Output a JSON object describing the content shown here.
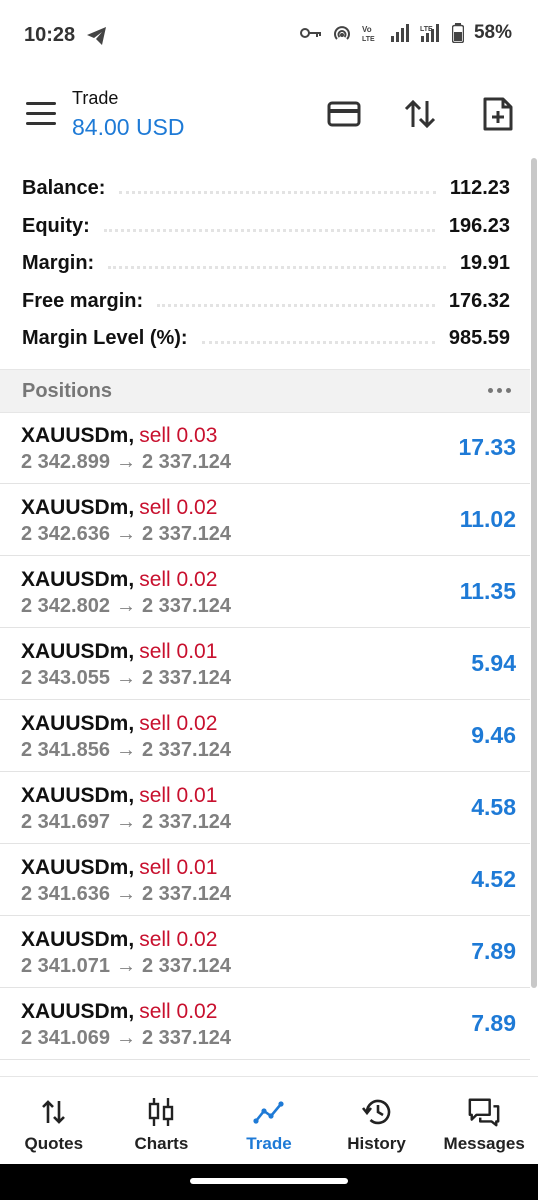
{
  "status_bar": {
    "time": "10:28",
    "battery": "58%",
    "icons": [
      "telegram-icon",
      "key-icon",
      "hotspot-icon",
      "volte-icon",
      "signal-icon",
      "lte-signal-icon",
      "battery-icon"
    ]
  },
  "header": {
    "title": "Trade",
    "balance": "84.00 USD",
    "icons": [
      "menu-icon",
      "card-icon",
      "sort-icon",
      "new-order-icon"
    ]
  },
  "account": [
    {
      "label": "Balance:",
      "value": "112.23"
    },
    {
      "label": "Equity:",
      "value": "196.23"
    },
    {
      "label": "Margin:",
      "value": "19.91"
    },
    {
      "label": "Free margin:",
      "value": "176.32"
    },
    {
      "label": "Margin Level (%):",
      "value": "985.59"
    }
  ],
  "positions_header": {
    "title": "Positions"
  },
  "positions": [
    {
      "symbol": "XAUUSDm,",
      "type": "sell 0.03",
      "open": "2 342.899",
      "current": "2 337.124",
      "profit": "17.33"
    },
    {
      "symbol": "XAUUSDm,",
      "type": "sell 0.02",
      "open": "2 342.636",
      "current": "2 337.124",
      "profit": "11.02"
    },
    {
      "symbol": "XAUUSDm,",
      "type": "sell 0.02",
      "open": "2 342.802",
      "current": "2 337.124",
      "profit": "11.35"
    },
    {
      "symbol": "XAUUSDm,",
      "type": "sell 0.01",
      "open": "2 343.055",
      "current": "2 337.124",
      "profit": "5.94"
    },
    {
      "symbol": "XAUUSDm,",
      "type": "sell 0.02",
      "open": "2 341.856",
      "current": "2 337.124",
      "profit": "9.46"
    },
    {
      "symbol": "XAUUSDm,",
      "type": "sell 0.01",
      "open": "2 341.697",
      "current": "2 337.124",
      "profit": "4.58"
    },
    {
      "symbol": "XAUUSDm,",
      "type": "sell 0.01",
      "open": "2 341.636",
      "current": "2 337.124",
      "profit": "4.52"
    },
    {
      "symbol": "XAUUSDm,",
      "type": "sell 0.02",
      "open": "2 341.071",
      "current": "2 337.124",
      "profit": "7.89"
    },
    {
      "symbol": "XAUUSDm,",
      "type": "sell 0.02",
      "open": "2 341.069",
      "current": "2 337.124",
      "profit": "7.89"
    }
  ],
  "bottom_nav": [
    {
      "label": "Quotes",
      "icon": "quotes-icon"
    },
    {
      "label": "Charts",
      "icon": "charts-icon"
    },
    {
      "label": "Trade",
      "icon": "trade-icon",
      "active": true
    },
    {
      "label": "History",
      "icon": "history-icon"
    },
    {
      "label": "Messages",
      "icon": "messages-icon"
    }
  ],
  "colors": {
    "accent": "#1e7ad6",
    "sell": "#c8102e",
    "muted": "#808080"
  }
}
